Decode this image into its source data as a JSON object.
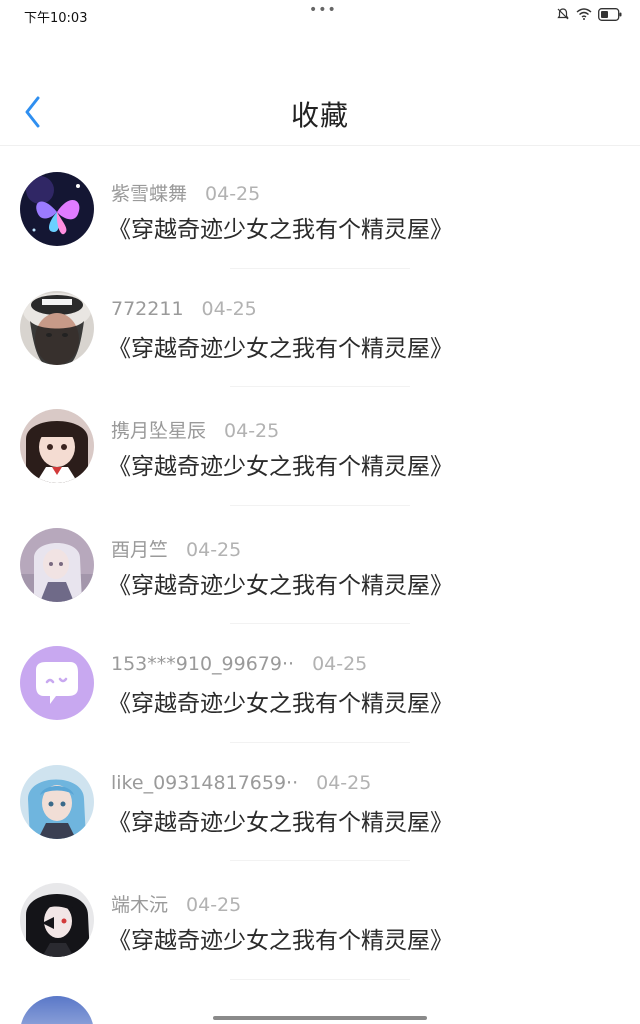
{
  "status": {
    "time": "下午10:03",
    "dots": "•••"
  },
  "header": {
    "title": "收藏"
  },
  "items": [
    {
      "user": "紫雪蝶舞",
      "date": "04-25",
      "title": "《穿越奇迹少女之我有个精灵屋》"
    },
    {
      "user": "772211",
      "date": "04-25",
      "title": "《穿越奇迹少女之我有个精灵屋》"
    },
    {
      "user": "携月坠星辰",
      "date": "04-25",
      "title": "《穿越奇迹少女之我有个精灵屋》"
    },
    {
      "user": "酉月竺",
      "date": "04-25",
      "title": "《穿越奇迹少女之我有个精灵屋》"
    },
    {
      "user": "153***910_99679··",
      "date": "04-25",
      "title": "《穿越奇迹少女之我有个精灵屋》"
    },
    {
      "user": "like_09314817659··",
      "date": "04-25",
      "title": "《穿越奇迹少女之我有个精灵屋》"
    },
    {
      "user": "端木沅",
      "date": "04-25",
      "title": "《穿越奇迹少女之我有个精灵屋》"
    }
  ],
  "colors": {
    "accent": "#2f8ff0",
    "default_avatar": "#c8a8f0"
  }
}
